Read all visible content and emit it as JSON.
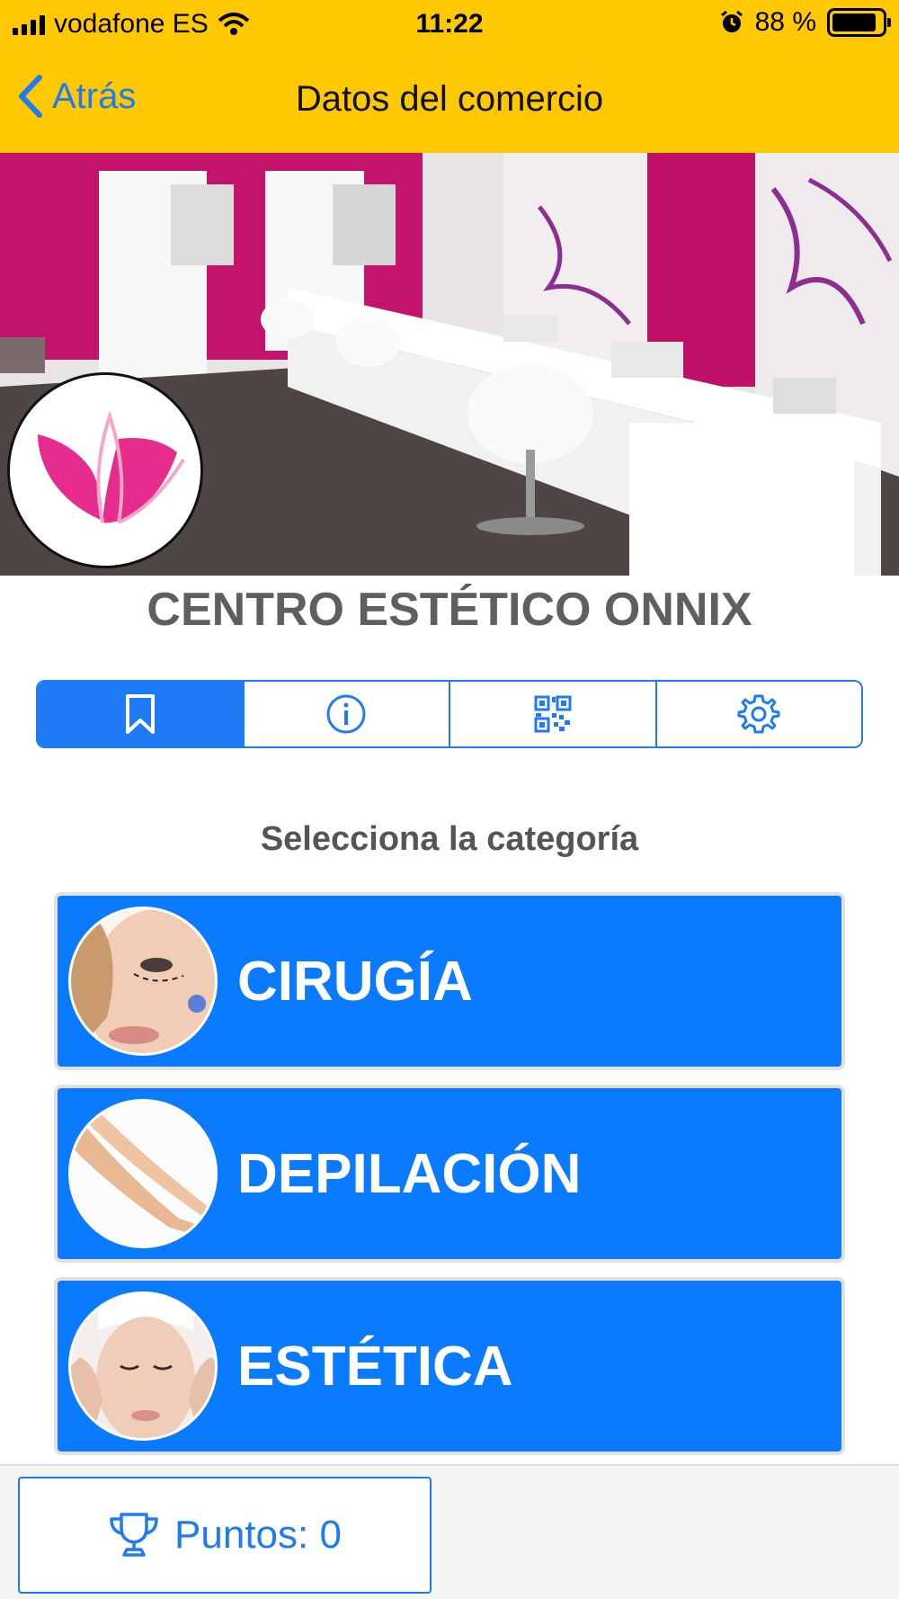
{
  "status_bar": {
    "carrier": "vodafone ES",
    "time": "11:22",
    "battery": "88 %",
    "battery_level": 0.88
  },
  "nav": {
    "back_label": "Atrás",
    "title": "Datos del comercio"
  },
  "business": {
    "name": "CENTRO ESTÉTICO ONNIX"
  },
  "segments": [
    {
      "icon": "bookmark-icon",
      "selected": true
    },
    {
      "icon": "info-icon",
      "selected": false
    },
    {
      "icon": "qr-code-icon",
      "selected": false
    },
    {
      "icon": "gear-icon",
      "selected": false
    }
  ],
  "categories_section": {
    "title": "Selecciona la categoría",
    "items": [
      {
        "label": "CIRUGÍA"
      },
      {
        "label": "DEPILACIÓN"
      },
      {
        "label": "ESTÉTICA"
      }
    ]
  },
  "footer": {
    "points_label": "Puntos: 0"
  },
  "colors": {
    "nav_bg": "#FFC800",
    "accent": "#1E7BF5",
    "category_bg": "#0A7BFF"
  }
}
